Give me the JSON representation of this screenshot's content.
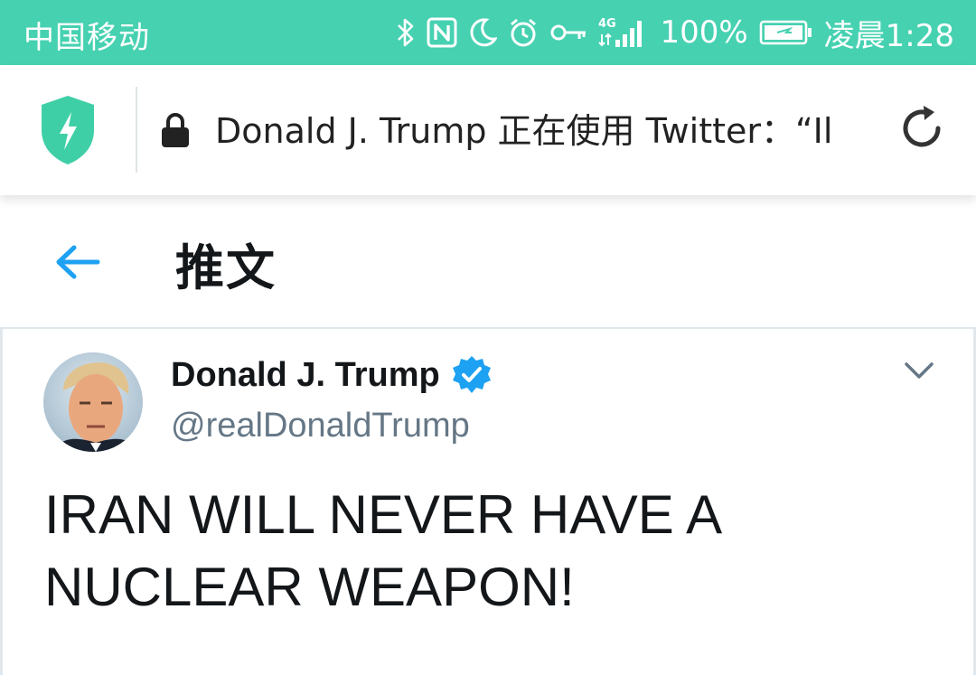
{
  "status_bar": {
    "carrier": "中国移动",
    "battery_percent": "100%",
    "time": "凌晨1:28",
    "icons": [
      "bluetooth-icon",
      "nfc-icon",
      "moon-icon",
      "alarm-icon",
      "key-icon",
      "4g-signal-icon",
      "battery-charging-icon"
    ],
    "network_label": "4G",
    "background_color": "#46d1b1"
  },
  "browser": {
    "shield_icon": "shield-bolt-icon",
    "lock_icon": "lock-icon",
    "url_text": "Donald J. Trump 正在使用 Twitter：“Il",
    "reload_icon": "reload-icon",
    "shield_color": "#3fcfa6"
  },
  "twitter_header": {
    "back_icon": "back-arrow-icon",
    "title": "推文",
    "accent_color": "#1da1f2"
  },
  "tweet": {
    "author_name": "Donald J. Trump",
    "verified_icon": "verified-badge-icon",
    "handle": "@realDonaldTrump",
    "menu_icon": "chevron-down-icon",
    "text": "IRAN WILL NEVER HAVE A NUCLEAR WEAPON!"
  }
}
